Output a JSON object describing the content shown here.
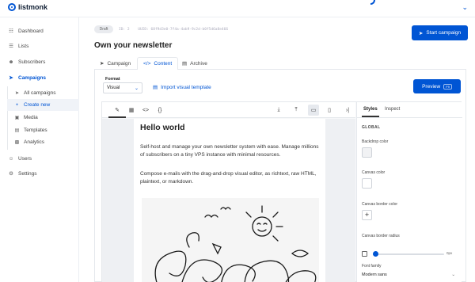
{
  "app": {
    "name": "listmonk"
  },
  "sidebar": {
    "items": [
      {
        "label": "Dashboard",
        "icon": "dashboard-icon"
      },
      {
        "label": "Lists",
        "icon": "list-icon"
      },
      {
        "label": "Subscribers",
        "icon": "users-icon"
      },
      {
        "label": "Campaigns",
        "icon": "rocket-icon"
      },
      {
        "label": "Users",
        "icon": "user-icon"
      },
      {
        "label": "Settings",
        "icon": "gear-icon"
      }
    ],
    "campaign_subitems": [
      {
        "label": "All campaigns",
        "icon": "rocket-icon"
      },
      {
        "label": "Create new",
        "icon": "plus-icon"
      },
      {
        "label": "Media",
        "icon": "image-icon"
      },
      {
        "label": "Templates",
        "icon": "file-icon"
      },
      {
        "label": "Analytics",
        "icon": "chart-icon"
      }
    ]
  },
  "campaign": {
    "status": "Draft",
    "id_label": "ID: 2",
    "uuid": "UUID: 68f9d3e0-7f4a-4ab9-9c2d-b0f5d6a8e466",
    "title": "Own your newsletter",
    "start_label": "Start campaign"
  },
  "tabs": [
    {
      "label": "Campaign",
      "icon": "rocket-icon"
    },
    {
      "label": "Content",
      "icon": "code-icon"
    },
    {
      "label": "Archive",
      "icon": "archive-icon"
    }
  ],
  "editor": {
    "format_label": "Format",
    "format_value": "Visual",
    "import_label": "Import visual template",
    "preview_label": "Preview",
    "preview_shortcut": "F9"
  },
  "canvas": {
    "heading": "Hello world",
    "para1": "Self-host and manage your own newsletter system with ease. Manage millions of subscribers on a tiny VPS instance with minimal resources.",
    "para2": "Compose e-mails with the drag-and-drop visual editor, as richtext, raw HTML, plaintext, or markdown."
  },
  "panel": {
    "tab_styles": "Styles",
    "tab_inspect": "Inspect",
    "section": "GLOBAL",
    "backdrop_color": "Backdrop color",
    "canvas_color": "Canvas color",
    "canvas_border_color": "Canvas border color",
    "canvas_border_radius": "Canvas border radius",
    "border_radius_value": "0px",
    "font_family_label": "Font family",
    "font_family_value": "Modern sans",
    "border_radius_fraction": 0.02
  },
  "colors": {
    "accent": "#0055d4"
  }
}
